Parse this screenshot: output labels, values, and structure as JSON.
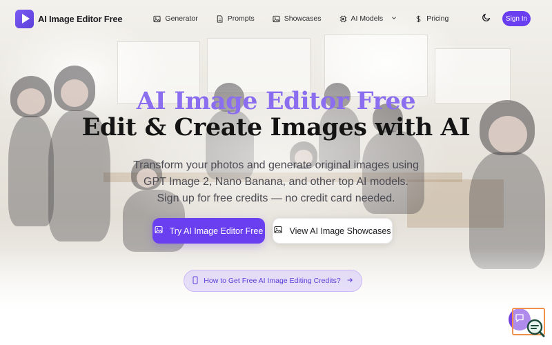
{
  "header": {
    "logo_text": "AI Image Editor Free",
    "nav": [
      {
        "label": "Generator",
        "icon": "image-icon"
      },
      {
        "label": "Prompts",
        "icon": "document-icon"
      },
      {
        "label": "Showcases",
        "icon": "image-icon"
      },
      {
        "label": "AI Models",
        "icon": "chip-icon",
        "has_dropdown": true
      },
      {
        "label": "Pricing",
        "icon": "dollar-icon"
      }
    ],
    "theme_icon": "moon-icon",
    "signin_label": "Sign In"
  },
  "hero": {
    "title_accent": "AI Image Editor Free",
    "title_main": "Edit & Create Images with AI",
    "subtitle": "Transform your photos and generate original images using GPT Image 2, Nano Banana, and other top AI models. Sign up for free credits — no credit card needed.",
    "primary_cta": "Try AI Image Editor Free",
    "secondary_cta": "View AI Image Showcases",
    "credits_link": "How to Get Free AI Image Editing Credits?"
  },
  "colors": {
    "brand": "#6a3ff0",
    "accent_title": "#8b6df0",
    "pill_bg": "#e4d9fb",
    "feedback_border": "#f0904a"
  },
  "widgets": {
    "chat_icon": "chat-icon",
    "search_chat_icon": "search-chat-icon"
  }
}
